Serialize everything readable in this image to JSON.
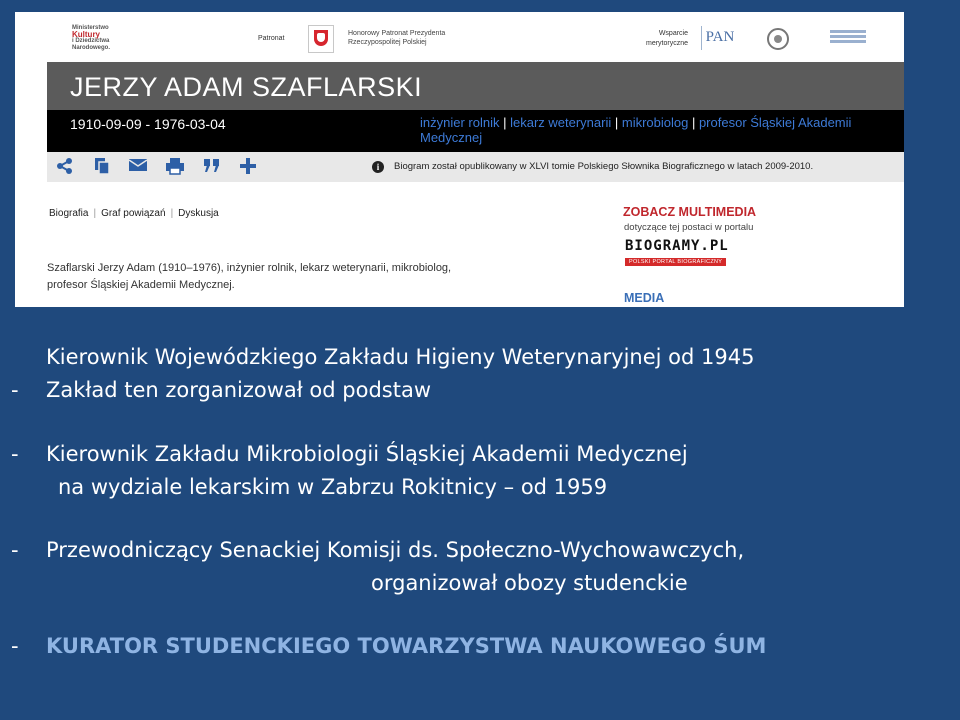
{
  "web": {
    "header": {
      "ministry_lines": [
        "Ministerstwo",
        "Kultury",
        "i Dziedzictwa",
        "Narodowego."
      ],
      "patronat_label": "Patronat",
      "patronat_text_1": "Honorowy Patronat Prezydenta",
      "patronat_text_2": "Rzeczypospolitej Polskiej",
      "wsparcie_1": "Wsparcie",
      "wsparcie_2": "merytoryczne",
      "pan_logo": "PAN"
    },
    "person": {
      "name": "JERZY ADAM SZAFLARSKI",
      "dates": "1910-09-09 - 1976-03-04",
      "professions": [
        "inżynier rolnik",
        "lekarz weterynarii",
        "mikrobiolog",
        "profesor Śląskiej Akademii Medycznej"
      ],
      "separator": " | "
    },
    "toolbar": {
      "icons": [
        "share-icon",
        "copy-icon",
        "email-icon",
        "print-icon",
        "quote-icon",
        "plus-icon"
      ],
      "info_text": "Biogram został opublikowany w XLVI tomie Polskiego Słownika Biograficznego w latach 2009-2010."
    },
    "tabs": [
      "Biografia",
      "Graf powiązań",
      "Dyskusja"
    ],
    "summary_line_1": "Szaflarski Jerzy Adam (1910–1976), inżynier rolnik, lekarz weterynarii, mikrobiolog,",
    "summary_line_2": "profesor Śląskiej Akademii Medycznej.",
    "sidebar": {
      "title": "ZOBACZ MULTIMEDIA",
      "subtitle": "dotyczące tej postaci w portalu",
      "logo": "BIOGRAMY.PL",
      "logo_tag": "POLSKI PORTAL BIOGRAFICZNY",
      "media": "MEDIA"
    }
  },
  "slide": {
    "line1": "Kierownik Wojewódzkiego Zakładu Higieny Weterynaryjnej od 1945",
    "line2": "Zakład ten zorganizował od podstaw",
    "line3": "Kierownik Zakładu Mikrobiologii  Śląskiej Akademii Medycznej",
    "line4": "na wydziale lekarskim w Zabrzu Rokitnicy – od 1959",
    "line5": "Przewodniczący Senackiej Komisji ds. Społeczno-Wychowawczych,",
    "line6": "organizował obozy studenckie",
    "line7": "KURATOR STUDENCKIEGO TOWARZYSTWA NAUKOWEGO ŚUM",
    "dash": "-"
  },
  "colors": {
    "background": "#1f497d",
    "kurator": "#8fb4e3",
    "profession_link": "#3d7ad6",
    "multimedia_red": "#c0272d"
  }
}
